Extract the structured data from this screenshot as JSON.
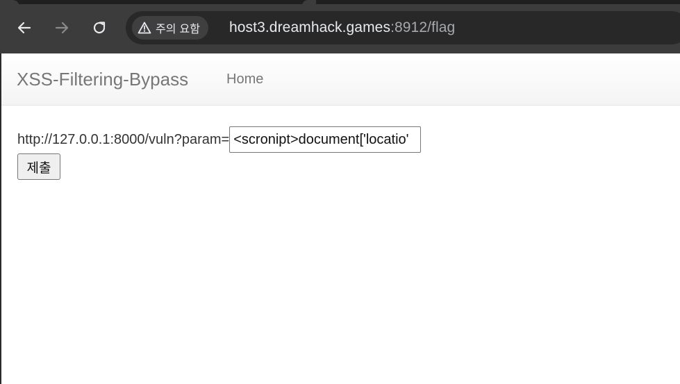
{
  "browser": {
    "security_label": "주의 요함",
    "url_host": "host3.dreamhack.games",
    "url_rest": ":8912/flag"
  },
  "navbar": {
    "brand": "XSS-Filtering-Bypass",
    "home_label": "Home"
  },
  "form": {
    "url_prefix": "http://127.0.0.1:8000/vuln?param=",
    "param_value": "<scronipt>document['locatio'",
    "submit_label": "제출"
  },
  "colors": {
    "toolbar_bg": "#3c3c3c",
    "omnibox_bg": "#282828",
    "navbar_text": "#777777",
    "body_text": "#333333"
  },
  "icons": {
    "back": "arrow-left-icon",
    "forward": "arrow-right-icon",
    "reload": "reload-icon",
    "warning": "warning-triangle-icon"
  }
}
